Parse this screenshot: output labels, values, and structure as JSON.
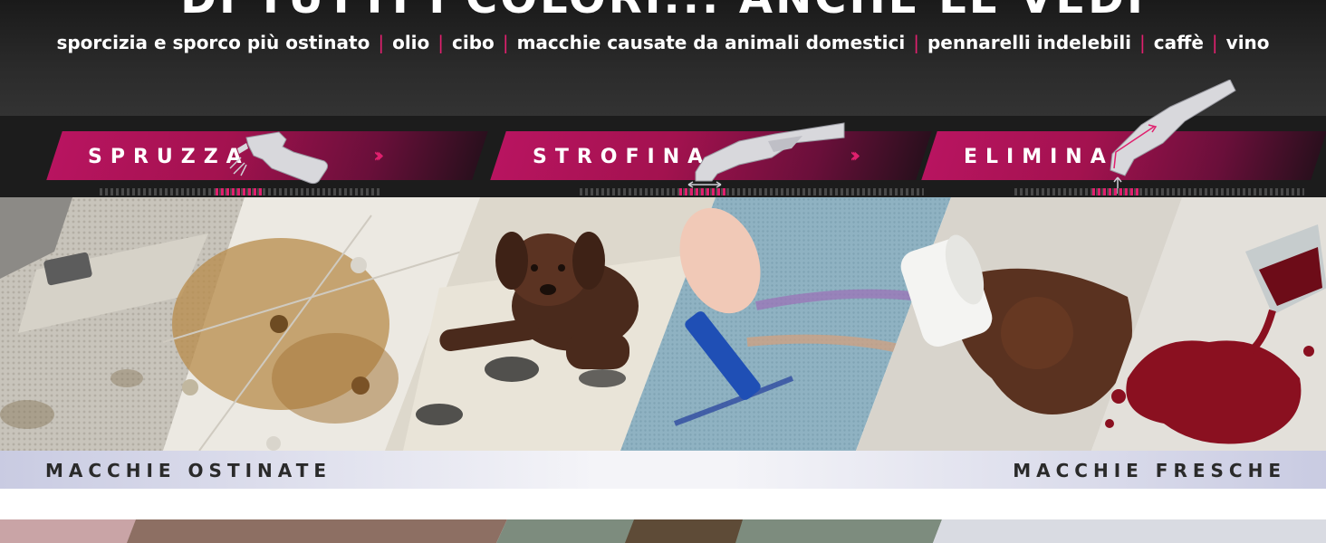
{
  "header": {
    "headline": "DI TUTTI I COLORI... ANCHE LE VEDI",
    "stains": [
      "sporcizia e sporco più ostinato",
      "olio",
      "cibo",
      "macchie causate da animali domestici",
      "pennarelli indelebili",
      "caffè",
      "vino"
    ],
    "separator": "|"
  },
  "steps": [
    {
      "label": "SPRUZZA",
      "icon": "spray-bottle-icon"
    },
    {
      "label": "STROFINA",
      "icon": "handheld-cleaner-icon"
    },
    {
      "label": "ELIMINA",
      "icon": "handheld-cleaner-suction-icon"
    }
  ],
  "step_arrows": "›››",
  "photos": [
    "stained-car-seat",
    "stained-upholstered-sofa",
    "puppy-on-dirty-rug",
    "marker-on-carpet",
    "spilled-coffee-on-carpet",
    "spilled-red-wine-on-carpet"
  ],
  "captions": {
    "left": "MACCHIE OSTINATE",
    "right": "MACCHIE FRESCHE"
  },
  "colors": {
    "accent": "#e0206e",
    "header_bg": "#2b2b2b",
    "step_bg": "#1c1c1c"
  }
}
